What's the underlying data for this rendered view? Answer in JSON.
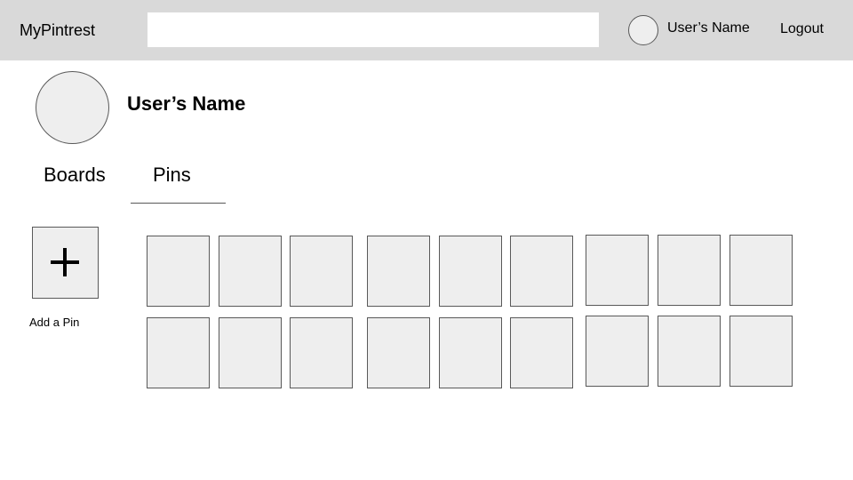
{
  "header": {
    "brand": "MyPintrest",
    "search_value": "",
    "user_name": "User’s Name",
    "logout_label": "Logout"
  },
  "profile": {
    "name": "User’s Name"
  },
  "tabs": [
    {
      "label": "Boards",
      "active": false
    },
    {
      "label": "Pins",
      "active": true
    }
  ],
  "add_pin": {
    "label": "Add a Pin",
    "icon": "plus-icon"
  },
  "pins": {
    "rows": 2,
    "per_row": 9,
    "count": 18
  },
  "colors": {
    "header_bg": "#d9d9d9",
    "placeholder_fill": "#eeeeee",
    "outline": "#595959"
  }
}
